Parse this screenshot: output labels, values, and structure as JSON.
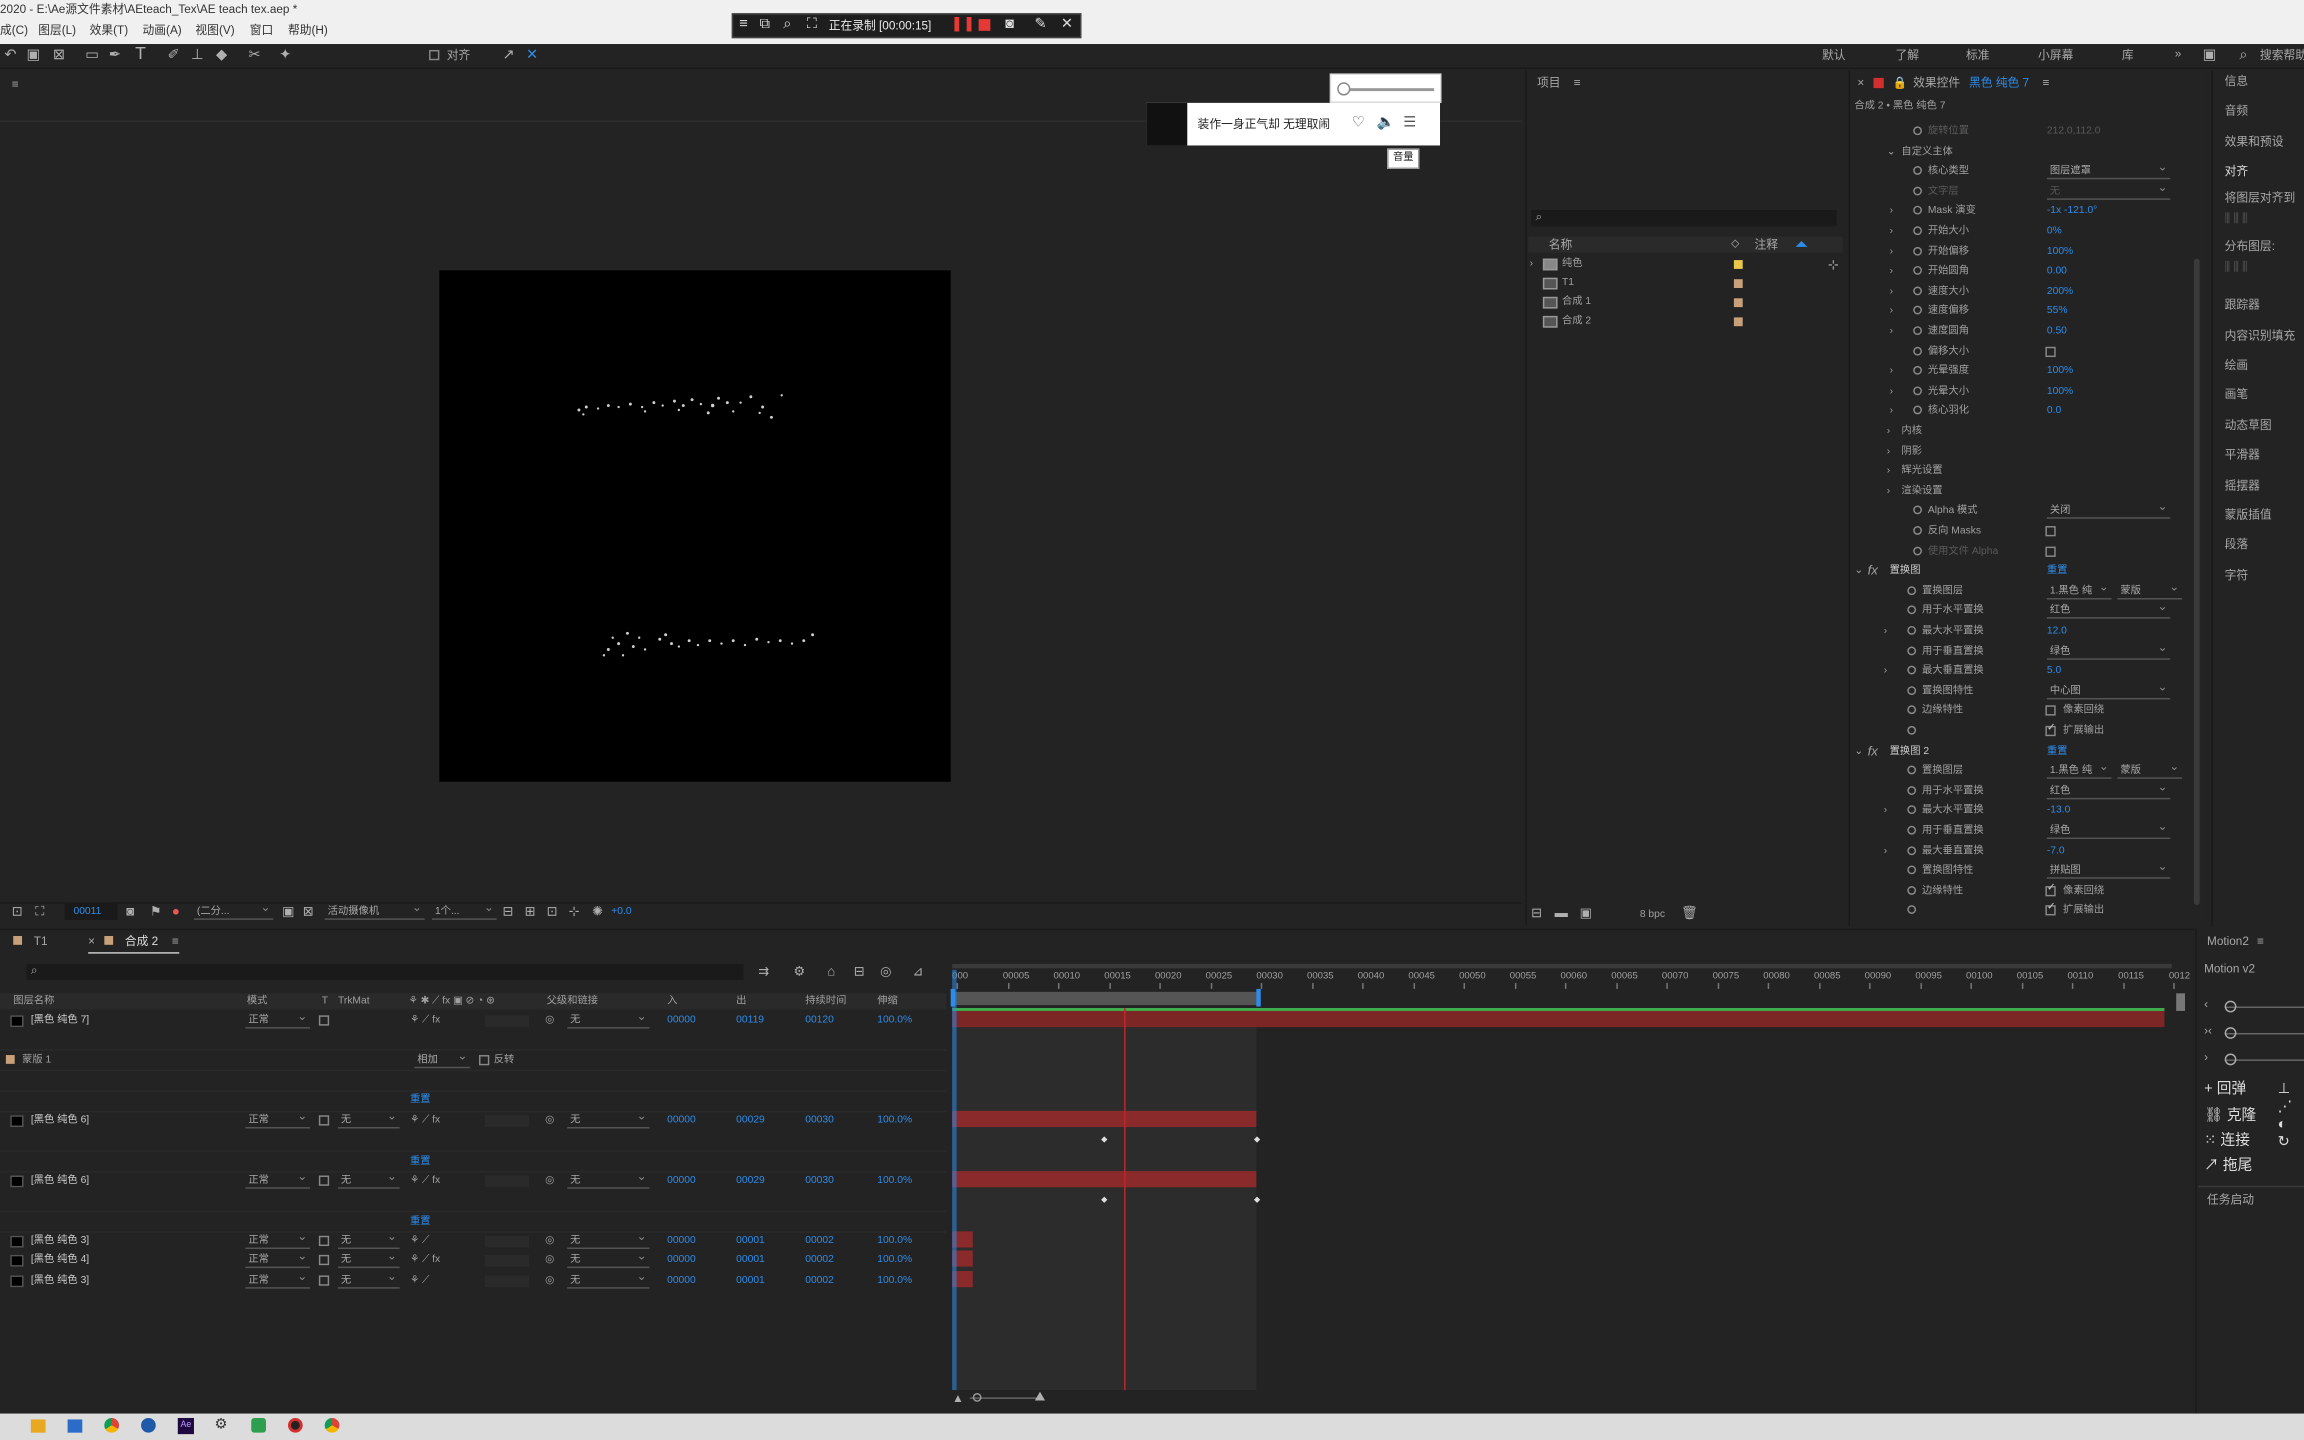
{
  "menubar": {
    "title": "2020 - E:\\Ae源文件素材\\AEteach_Tex\\AE teach tex.aep *",
    "items": [
      "成(C)",
      "图层(L)",
      "效果(T)",
      "动画(A)",
      "视图(V)",
      "窗口",
      "帮助(H)"
    ]
  },
  "recorder": {
    "status": "正在录制 [00:00:15]"
  },
  "toolbar": {
    "align_label": "对齐",
    "workspaces": [
      "默认",
      "了解",
      "标准",
      "小屏幕",
      "库"
    ],
    "search": "搜索帮助"
  },
  "music_popup": {
    "song": "装作一身正气却 无理取闹",
    "tooltip": "音量"
  },
  "project": {
    "title": "项目",
    "col_name": "名称",
    "col_note": "注释",
    "items": [
      "纯色",
      "T1",
      "合成 1",
      "合成 2"
    ]
  },
  "effects": {
    "title": "效果控件",
    "layer": "黑色 纯色 7",
    "crumb": "合成 2 • 黑色 纯色 7",
    "rows": [
      {
        "l": "旋转位置",
        "v": "212.0,112.0",
        "d": 1
      },
      {
        "l": "自定义主体",
        "v": ""
      },
      {
        "l": "核心类型",
        "v": "图层遮罩",
        "dd": 1
      },
      {
        "l": "文字层",
        "v": "无",
        "dd": 1,
        "d": 1
      },
      {
        "l": "Mask 演变",
        "v": "-1x -121.0°",
        "b": 1
      },
      {
        "l": "开始大小",
        "v": "0%",
        "b": 1
      },
      {
        "l": "开始偏移",
        "v": "100%",
        "b": 1
      },
      {
        "l": "开始圆角",
        "v": "0.00",
        "b": 1
      },
      {
        "l": "速度大小",
        "v": "200%",
        "b": 1
      },
      {
        "l": "速度偏移",
        "v": "55%",
        "b": 1
      },
      {
        "l": "速度圆角",
        "v": "0.50",
        "b": 1
      },
      {
        "l": "偏移大小",
        "v": "",
        "cb": 1
      },
      {
        "l": "光晕强度",
        "v": "100%",
        "b": 1
      },
      {
        "l": "光晕大小",
        "v": "100%",
        "b": 1
      },
      {
        "l": "核心羽化",
        "v": "0.0",
        "b": 1
      },
      {
        "l": "内核",
        "v": ""
      },
      {
        "l": "阴影",
        "v": ""
      },
      {
        "l": "辉光设置",
        "v": ""
      },
      {
        "l": "渲染设置",
        "v": ""
      },
      {
        "l": "Alpha 模式",
        "v": "关闭",
        "dd": 1
      },
      {
        "l": "反向 Masks",
        "v": "",
        "cb": 1
      },
      {
        "l": "使用文件 Alpha",
        "v": "",
        "cb": 1,
        "d": 1
      }
    ],
    "fx1": {
      "name": "置换图",
      "reset": "重置",
      "rows": [
        {
          "l": "置换图层",
          "v": "1.黑色 纯",
          "v2": "蒙版",
          "dd": 1
        },
        {
          "l": "用于水平置换",
          "v": "红色",
          "dd": 1
        },
        {
          "l": "最大水平置换",
          "v": "12.0",
          "b": 1
        },
        {
          "l": "用于垂直置换",
          "v": "绿色",
          "dd": 1
        },
        {
          "l": "最大垂直置换",
          "v": "5.0",
          "b": 1
        },
        {
          "l": "置换图特性",
          "v": "中心图",
          "dd": 1
        },
        {
          "l": "边缘特性",
          "v": "像素回绕",
          "cb": 1
        },
        {
          "l": "",
          "v": "扩展输出",
          "cb": 1,
          "on": 1
        }
      ]
    },
    "fx2": {
      "name": "置换图 2",
      "reset": "重置",
      "rows": [
        {
          "l": "置换图层",
          "v": "1.黑色 纯",
          "v2": "蒙版",
          "dd": 1
        },
        {
          "l": "用于水平置换",
          "v": "红色",
          "dd": 1
        },
        {
          "l": "最大水平置换",
          "v": "-13.0",
          "b": 1
        },
        {
          "l": "用于垂直置换",
          "v": "绿色",
          "dd": 1
        },
        {
          "l": "最大垂直置换",
          "v": "-7.0",
          "b": 1
        },
        {
          "l": "置换图特性",
          "v": "拼贴图",
          "dd": 1
        },
        {
          "l": "边缘特性",
          "v": "像素回绕",
          "cb": 1,
          "on": 1
        },
        {
          "l": "",
          "v": "扩展输出",
          "cb": 1,
          "on": 1
        }
      ]
    }
  },
  "right_panel": {
    "items": [
      "信息",
      "音频",
      "效果和预设",
      "对齐",
      "将图层对齐到",
      "分布图层:",
      "跟踪器",
      "内容识别填充",
      "绘画",
      "画笔",
      "动态草图",
      "平滑器",
      "摇摆器",
      "蒙版插值",
      "段落",
      "字符"
    ]
  },
  "viewer_bar": {
    "time": "00011",
    "res": "(二分...",
    "camera": "活动摄像机",
    "views": "1个...",
    "exposure": "+0.0"
  },
  "project_bar": {
    "bpc": "8 bpc"
  },
  "timeline": {
    "tab1": "T1",
    "tab2": "合成 2",
    "cols": {
      "name": "图层名称",
      "mode": "模式",
      "t": "T",
      "trkmat": "TrkMat",
      "parent": "父级和链接",
      "in": "入",
      "out": "出",
      "dur": "持续时间",
      "stretch": "伸缩"
    },
    "ticks": [
      "000",
      "00005",
      "00010",
      "00015",
      "00020",
      "00025",
      "00030",
      "00035",
      "00040",
      "00045",
      "00050",
      "00055",
      "00060",
      "00065",
      "00070",
      "00075",
      "00080",
      "00085",
      "00090",
      "00095",
      "00100",
      "00105",
      "00110",
      "00115",
      "0012"
    ],
    "layers": [
      {
        "name": "[黑色 纯色 7]",
        "mode": "正常",
        "trk": "",
        "parent": "无",
        "in": "00000",
        "out": "00119",
        "dur": "00120",
        "st": "100.0%"
      },
      {
        "name": "[黑色 纯色 6]",
        "mode": "正常",
        "trk": "无",
        "parent": "无",
        "in": "00000",
        "out": "00029",
        "dur": "00030",
        "st": "100.0%"
      },
      {
        "name": "[黑色 纯色 6]",
        "mode": "正常",
        "trk": "无",
        "parent": "无",
        "in": "00000",
        "out": "00029",
        "dur": "00030",
        "st": "100.0%"
      },
      {
        "name": "[黑色 纯色 3]",
        "mode": "正常",
        "trk": "无",
        "parent": "无",
        "in": "00000",
        "out": "00001",
        "dur": "00002",
        "st": "100.0%"
      },
      {
        "name": "[黑色 纯色 4]",
        "mode": "正常",
        "trk": "无",
        "parent": "无",
        "in": "00000",
        "out": "00001",
        "dur": "00002",
        "st": "100.0%"
      },
      {
        "name": "[黑色 纯色 3]",
        "mode": "正常",
        "trk": "无",
        "parent": "无",
        "in": "00000",
        "out": "00001",
        "dur": "00002",
        "st": "100.0%"
      }
    ],
    "mask": {
      "name": "蒙版 1",
      "mode": "相加",
      "invert": "反转"
    },
    "reset": "重置"
  },
  "motion": {
    "title": "Motion2",
    "version": "Motion v2",
    "btns": [
      "回弹",
      "克隆",
      "连接",
      "拖尾"
    ],
    "task": "任务启动"
  },
  "colors": {
    "accent": "#2d8ceb",
    "bar": "#8b2a2a",
    "playhead": "#c0272d",
    "label_yellow": "#e8c84a",
    "label_tan": "#c8a07a"
  }
}
